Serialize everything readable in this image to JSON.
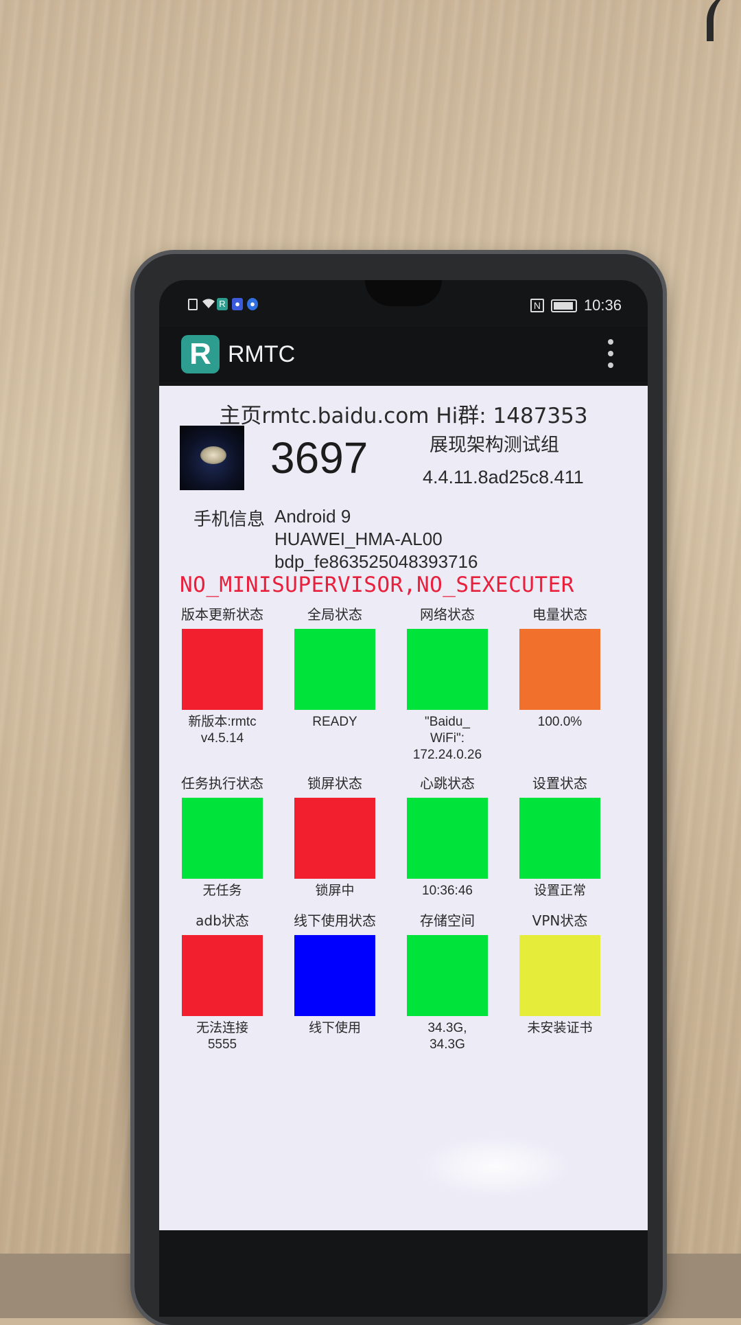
{
  "status_bar": {
    "time": "10:36",
    "icons": [
      "sim-icon",
      "wifi-icon",
      "rmtc-notification-icon",
      "baidu-paw-icon",
      "baidu-app-icon",
      "nfc-icon",
      "battery-icon"
    ],
    "nfc_glyph": "N"
  },
  "app_bar": {
    "logo_letter": "R",
    "title": "RMTC"
  },
  "header": {
    "homepage_line": "主页rmtc.baidu.com Hi群: 1487353"
  },
  "device": {
    "number": "3697",
    "group": "展现架构测试组",
    "version": "4.4.11.8ad25c8.411"
  },
  "phone_info": {
    "label": "手机信息",
    "os": "Android 9",
    "model": "HUAWEI_HMA-AL00",
    "serial": "bdp_fe863525048393716"
  },
  "warning": "NO_MINISUPERVISOR,NO_SEXECUTER",
  "colors": {
    "red": "#f2202e",
    "green": "#00e33a",
    "orange": "#f0702c",
    "blue": "#0000ff",
    "yellow": "#e6ec3a",
    "warning_text": "#e8203c",
    "app_teal": "#2d9d8f"
  },
  "status_grid": [
    {
      "label": "版本更新状态",
      "value": "新版本:rmtc\nv4.5.14",
      "color": "#f2202e"
    },
    {
      "label": "全局状态",
      "value": "READY",
      "color": "#00e33a"
    },
    {
      "label": "网络状态",
      "value": "\"Baidu_\nWiFi\":\n172.24.0.26",
      "color": "#00e33a"
    },
    {
      "label": "电量状态",
      "value": "100.0%",
      "color": "#f0702c"
    },
    {
      "label": "任务执行状态",
      "value": "无任务",
      "color": "#00e33a"
    },
    {
      "label": "锁屏状态",
      "value": "锁屏中",
      "color": "#f2202e"
    },
    {
      "label": "心跳状态",
      "value": "10:36:46",
      "color": "#00e33a"
    },
    {
      "label": "设置状态",
      "value": "设置正常",
      "color": "#00e33a"
    },
    {
      "label": "adb状态",
      "value": "无法连接\n5555",
      "color": "#f2202e"
    },
    {
      "label": "线下使用状态",
      "value": "线下使用",
      "color": "#0000ff"
    },
    {
      "label": "存储空间",
      "value": "34.3G,\n34.3G",
      "color": "#00e33a"
    },
    {
      "label": "VPN状态",
      "value": "未安装证书",
      "color": "#e6ec3a"
    }
  ]
}
